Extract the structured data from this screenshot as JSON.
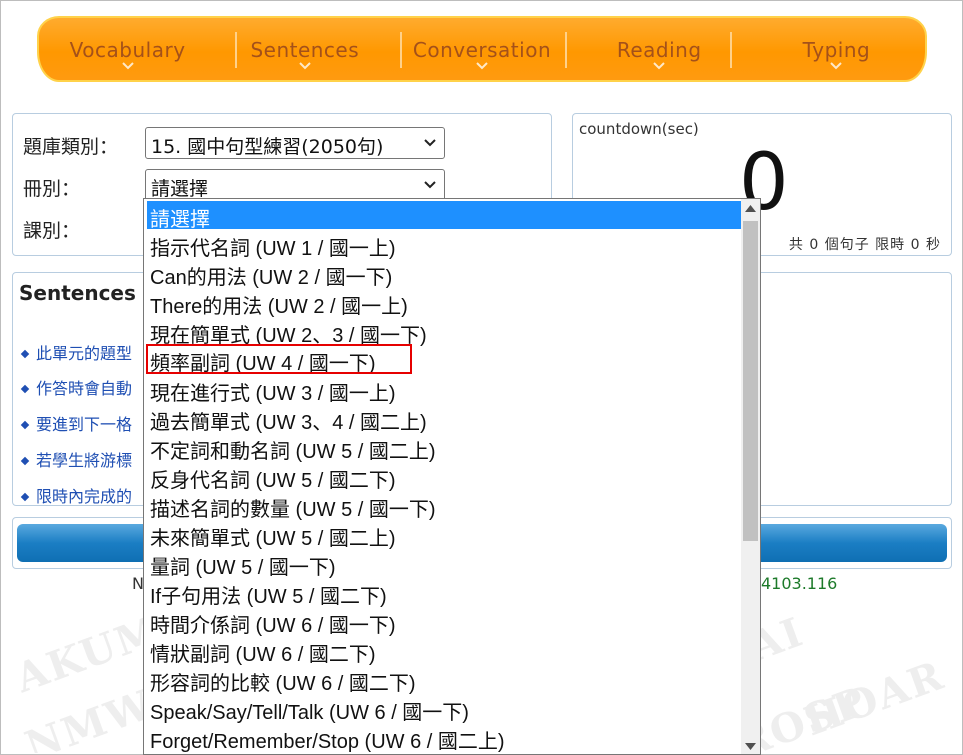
{
  "nav": {
    "items": [
      {
        "label": "Vocabulary"
      },
      {
        "label": "Sentences"
      },
      {
        "label": "Conversation"
      },
      {
        "label": "Reading"
      },
      {
        "label": "Typing"
      }
    ]
  },
  "form": {
    "category_label": "題庫類別：",
    "category_value": "15. 國中句型練習(2050句)",
    "volume_label": "冊別：",
    "volume_value": "請選擇",
    "lesson_label": "課別："
  },
  "countdown": {
    "label": "countdown(sec)",
    "value": "0",
    "info": "共 0 個句子 限時 0 秒"
  },
  "sentences_panel": {
    "title": "Sentences f",
    "bullets": [
      "此單元的題型",
      "作答時會自動",
      "要進到下一格",
      "若學生將游標",
      "限時內完成的"
    ]
  },
  "footer": {
    "n_text": "N",
    "number_text": "4103.116"
  },
  "dropdown": {
    "options": [
      "請選擇",
      "指示代名詞 (UW 1 / 國一上)",
      "Can的用法 (UW 2 / 國一下)",
      "There的用法 (UW 2 / 國一上)",
      "現在簡單式 (UW 2、3 / 國一下)",
      "頻率副詞 (UW 4 / 國一下)",
      "現在進行式 (UW 3 / 國一上)",
      "過去簡單式 (UW 3、4 / 國二上)",
      "不定詞和動名詞 (UW 5 / 國二上)",
      "反身代名詞 (UW 5 / 國二下)",
      "描述名詞的數量 (UW 5 / 國一下)",
      "未來簡單式 (UW 5 / 國二上)",
      "量詞 (UW 5 / 國一下)",
      "If子句用法 (UW 5 / 國二下)",
      "時間介係詞 (UW 6 / 國一下)",
      "情狀副詞 (UW 6 / 國二下)",
      "形容詞的比較 (UW 6 / 國二下)",
      "Speak/Say/Tell/Talk (UW 6 / 國一下)",
      "Forget/Remember/Stop (UW 6 / 國二上)"
    ]
  },
  "colors": {
    "nav_orange": "#ff9800",
    "nav_text": "#a4511a",
    "selected_blue": "#1e90ff",
    "highlight_red": "#e60000",
    "link_blue": "#1f4fb3"
  }
}
